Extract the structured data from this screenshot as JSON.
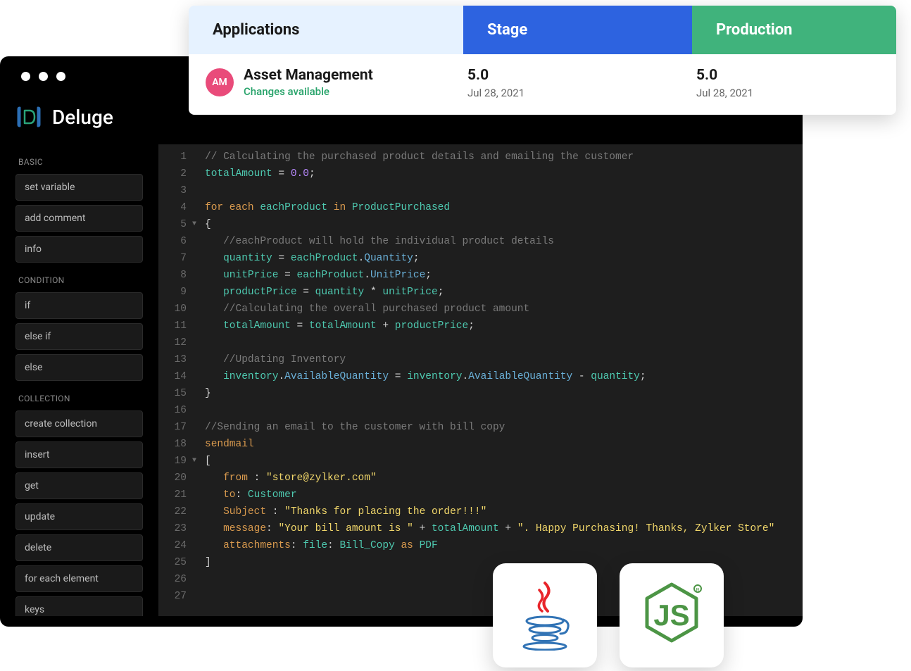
{
  "brand": "Deluge",
  "sidebar": {
    "sections": [
      {
        "label": "BASIC",
        "items": [
          "set variable",
          "add comment",
          "info"
        ]
      },
      {
        "label": "CONDITION",
        "items": [
          "if",
          "else if",
          "else"
        ]
      },
      {
        "label": "COLLECTION",
        "items": [
          "create collection",
          "insert",
          "get",
          "update",
          "delete",
          "for each element",
          "keys"
        ]
      }
    ]
  },
  "code": {
    "lines": [
      {
        "n": 1,
        "t": [
          [
            "comment",
            "// Calculating the purchased product details and emailing the customer"
          ]
        ]
      },
      {
        "n": 2,
        "t": [
          [
            "var",
            "totalAmount"
          ],
          [
            "op",
            " = "
          ],
          [
            "num",
            "0.0"
          ],
          [
            "op",
            ";"
          ]
        ]
      },
      {
        "n": 3,
        "t": []
      },
      {
        "n": 4,
        "t": [
          [
            "kw",
            "for each"
          ],
          [
            "white",
            " "
          ],
          [
            "var",
            "eachProduct"
          ],
          [
            "white",
            " "
          ],
          [
            "kw",
            "in"
          ],
          [
            "white",
            " "
          ],
          [
            "var",
            "ProductPurchased"
          ]
        ]
      },
      {
        "n": 5,
        "fold": true,
        "t": [
          [
            "op",
            "{"
          ]
        ]
      },
      {
        "n": 6,
        "t": [
          [
            "white",
            "   "
          ],
          [
            "comment",
            "//eachProduct will hold the individual product details"
          ]
        ]
      },
      {
        "n": 7,
        "t": [
          [
            "white",
            "   "
          ],
          [
            "var",
            "quantity"
          ],
          [
            "op",
            " = "
          ],
          [
            "var",
            "eachProduct"
          ],
          [
            "op",
            "."
          ],
          [
            "member",
            "Quantity"
          ],
          [
            "op",
            ";"
          ]
        ]
      },
      {
        "n": 8,
        "t": [
          [
            "white",
            "   "
          ],
          [
            "var",
            "unitPrice"
          ],
          [
            "op",
            " = "
          ],
          [
            "var",
            "eachProduct"
          ],
          [
            "op",
            "."
          ],
          [
            "member",
            "UnitPrice"
          ],
          [
            "op",
            ";"
          ]
        ]
      },
      {
        "n": 9,
        "t": [
          [
            "white",
            "   "
          ],
          [
            "var",
            "productPrice"
          ],
          [
            "op",
            " = "
          ],
          [
            "var",
            "quantity"
          ],
          [
            "op",
            " * "
          ],
          [
            "var",
            "unitPrice"
          ],
          [
            "op",
            ";"
          ]
        ]
      },
      {
        "n": 10,
        "t": [
          [
            "white",
            "   "
          ],
          [
            "comment",
            "//Calculating the overall purchased product amount"
          ]
        ]
      },
      {
        "n": 11,
        "t": [
          [
            "white",
            "   "
          ],
          [
            "var",
            "totalAmount"
          ],
          [
            "op",
            " = "
          ],
          [
            "var",
            "totalAmount"
          ],
          [
            "op",
            " + "
          ],
          [
            "var",
            "productPrice"
          ],
          [
            "op",
            ";"
          ]
        ]
      },
      {
        "n": 12,
        "t": []
      },
      {
        "n": 13,
        "t": [
          [
            "white",
            "   "
          ],
          [
            "comment",
            "//Updating Inventory"
          ]
        ]
      },
      {
        "n": 14,
        "t": [
          [
            "white",
            "   "
          ],
          [
            "var",
            "inventory"
          ],
          [
            "op",
            "."
          ],
          [
            "member",
            "AvailableQuantity"
          ],
          [
            "op",
            " = "
          ],
          [
            "var",
            "inventory"
          ],
          [
            "op",
            "."
          ],
          [
            "member",
            "AvailableQuantity"
          ],
          [
            "op",
            " - "
          ],
          [
            "var",
            "quantity"
          ],
          [
            "op",
            ";"
          ]
        ]
      },
      {
        "n": 15,
        "t": [
          [
            "op",
            "}"
          ]
        ]
      },
      {
        "n": 16,
        "t": []
      },
      {
        "n": 17,
        "t": [
          [
            "comment",
            "//Sending an email to the customer with bill copy"
          ]
        ]
      },
      {
        "n": 18,
        "t": [
          [
            "kw",
            "sendmail"
          ]
        ]
      },
      {
        "n": 19,
        "fold": true,
        "t": [
          [
            "op",
            "["
          ]
        ]
      },
      {
        "n": 20,
        "t": [
          [
            "white",
            "   "
          ],
          [
            "prop",
            "from"
          ],
          [
            "white",
            " "
          ],
          [
            "op",
            ":"
          ],
          [
            "white",
            " "
          ],
          [
            "str",
            "\"store@zylker.com\""
          ]
        ]
      },
      {
        "n": 21,
        "t": [
          [
            "white",
            "   "
          ],
          [
            "prop",
            "to"
          ],
          [
            "op",
            ":"
          ],
          [
            "white",
            " "
          ],
          [
            "var",
            "Customer"
          ]
        ]
      },
      {
        "n": 22,
        "t": [
          [
            "white",
            "   "
          ],
          [
            "prop",
            "Subject"
          ],
          [
            "white",
            " "
          ],
          [
            "op",
            ":"
          ],
          [
            "white",
            " "
          ],
          [
            "str",
            "\"Thanks for placing the order!!!\""
          ]
        ]
      },
      {
        "n": 23,
        "t": [
          [
            "white",
            "   "
          ],
          [
            "prop",
            "message"
          ],
          [
            "op",
            ":"
          ],
          [
            "white",
            " "
          ],
          [
            "str",
            "\"Your bill amount is \""
          ],
          [
            "op",
            " + "
          ],
          [
            "var",
            "totalAmount"
          ],
          [
            "op",
            " + "
          ],
          [
            "str",
            "\". Happy Purchasing! Thanks, Zylker Store\""
          ]
        ]
      },
      {
        "n": 24,
        "t": [
          [
            "white",
            "   "
          ],
          [
            "prop",
            "attachments"
          ],
          [
            "op",
            ":"
          ],
          [
            "white",
            " "
          ],
          [
            "var",
            "file"
          ],
          [
            "op",
            ":"
          ],
          [
            "white",
            " "
          ],
          [
            "var",
            "Bill_Copy"
          ],
          [
            "white",
            " "
          ],
          [
            "kw",
            "as"
          ],
          [
            "white",
            " "
          ],
          [
            "var",
            "PDF"
          ]
        ]
      },
      {
        "n": 25,
        "t": [
          [
            "op",
            "]"
          ]
        ]
      },
      {
        "n": 26,
        "t": []
      },
      {
        "n": 27,
        "t": []
      }
    ]
  },
  "status": {
    "tabs": {
      "apps": "Applications",
      "stage": "Stage",
      "prod": "Production"
    },
    "app": {
      "initials": "AM",
      "name": "Asset Management",
      "changes": "Changes available"
    },
    "stage": {
      "version": "5.0",
      "date": "Jul 28, 2021"
    },
    "prod": {
      "version": "5.0",
      "date": "Jul 28, 2021"
    }
  },
  "tech": {
    "java": "java-icon",
    "node": "nodejs-icon"
  }
}
